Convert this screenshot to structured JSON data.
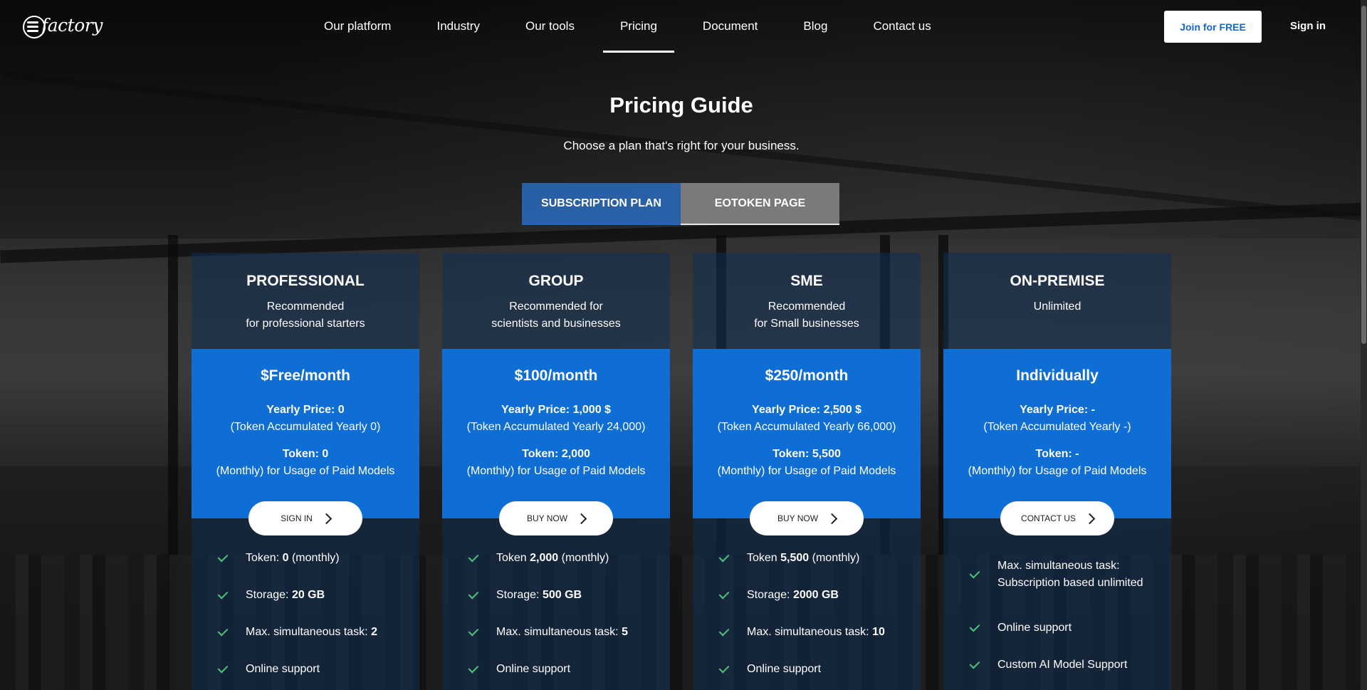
{
  "brand": {
    "logo_text": "factory",
    "logo_icon": "ei-logo-mark"
  },
  "nav": {
    "items": [
      "Our platform",
      "Industry",
      "Our tools",
      "Pricing",
      "Document",
      "Blog",
      "Contact us"
    ],
    "active": "Pricing",
    "join_label": "Join for FREE",
    "signin_label": "Sign in"
  },
  "hero": {
    "title": "Pricing Guide",
    "subtitle": "Choose a plan that's right for your business."
  },
  "tabs": {
    "subscription": "SUBSCRIPTION PLAN",
    "eotoken": "EOTOKEN PAGE",
    "active": "SUBSCRIPTION PLAN"
  },
  "plans": [
    {
      "name": "PROFESSIONAL",
      "rec1": "Recommended",
      "rec2": "for professional starters",
      "price": "$Free/month",
      "yearly_label": "Yearly Price: 0",
      "yearly_note": "(Token Accumulated Yearly 0)",
      "token_label": "Token: 0",
      "token_note": "(Monthly) for Usage of Paid Models",
      "cta": "SIGN IN",
      "features": [
        {
          "pre": "Token: ",
          "bold": "0",
          "post": " (monthly)"
        },
        {
          "pre": "Storage: ",
          "bold": "20 GB",
          "post": ""
        },
        {
          "pre": "Max. simultaneous task: ",
          "bold": "2",
          "post": ""
        },
        {
          "pre": "Online support",
          "bold": "",
          "post": ""
        }
      ]
    },
    {
      "name": "GROUP",
      "rec1": "Recommended for",
      "rec2": "scientists and businesses",
      "price": "$100/month",
      "yearly_label": "Yearly Price: 1,000 $",
      "yearly_note": "(Token Accumulated Yearly 24,000)",
      "token_label": "Token: 2,000",
      "token_note": "(Monthly) for Usage of Paid Models",
      "cta": "BUY NOW",
      "features": [
        {
          "pre": "Token ",
          "bold": "2,000",
          "post": " (monthly)"
        },
        {
          "pre": "Storage: ",
          "bold": "500 GB",
          "post": ""
        },
        {
          "pre": "Max. simultaneous task: ",
          "bold": "5",
          "post": ""
        },
        {
          "pre": "Online support",
          "bold": "",
          "post": ""
        }
      ]
    },
    {
      "name": "SME",
      "rec1": "Recommended",
      "rec2": "for Small businesses",
      "price": "$250/month",
      "yearly_label": "Yearly Price: 2,500 $",
      "yearly_note": "(Token Accumulated Yearly 66,000)",
      "token_label": "Token: 5,500",
      "token_note": "(Monthly) for Usage of Paid Models",
      "cta": "BUY NOW",
      "features": [
        {
          "pre": "Token ",
          "bold": "5,500",
          "post": " (monthly)"
        },
        {
          "pre": "Storage: ",
          "bold": "2000 GB",
          "post": ""
        },
        {
          "pre": "Max. simultaneous task: ",
          "bold": "10",
          "post": ""
        },
        {
          "pre": "Online support",
          "bold": "",
          "post": ""
        }
      ]
    },
    {
      "name": "ON-PREMISE",
      "rec1": "Unlimited",
      "rec2": "",
      "price": "Individually",
      "yearly_label": "Yearly Price: -",
      "yearly_note": "(Token Accumulated Yearly -)",
      "token_label": "Token: -",
      "token_note": "(Monthly) for Usage of Paid Models",
      "cta": "CONTACT US",
      "features": [
        {
          "pre": "Max. simultaneous task: Subscription based unlimited",
          "bold": "",
          "post": ""
        },
        {
          "pre": "Online support",
          "bold": "",
          "post": ""
        },
        {
          "pre": "Custom AI Model Support",
          "bold": "",
          "post": ""
        }
      ]
    }
  ],
  "colors": {
    "primary": "#0f6ed3",
    "check": "#4cc37a",
    "join_text": "#1668c5"
  }
}
